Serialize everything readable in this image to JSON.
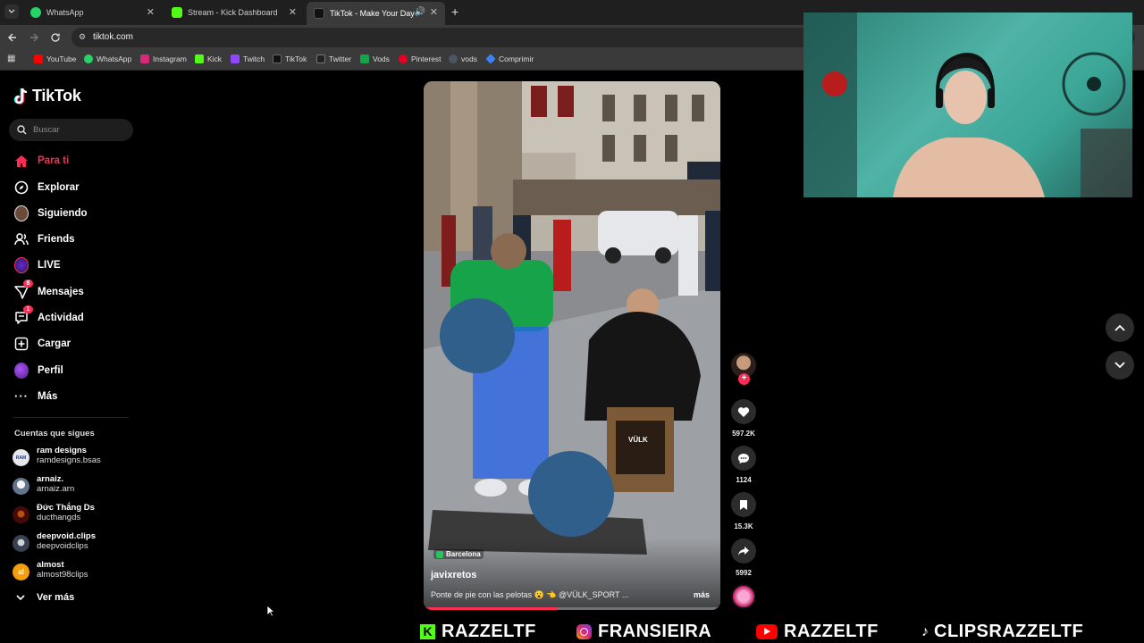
{
  "browser": {
    "tabs": [
      {
        "title": "WhatsApp",
        "color": "#25d366"
      },
      {
        "title": "Stream - Kick Dashboard",
        "color": "#53fc18"
      },
      {
        "title": "TikTok - Make Your Day",
        "color": "#111111"
      }
    ],
    "url": "tiktok.com",
    "bookmarks": [
      {
        "label": "YouTube",
        "color": "#ff0000"
      },
      {
        "label": "WhatsApp",
        "color": "#25d366"
      },
      {
        "label": "Instagram",
        "color": "#d62976"
      },
      {
        "label": "Kick",
        "color": "#53fc18"
      },
      {
        "label": "Twitch",
        "color": "#9146ff"
      },
      {
        "label": "TikTok",
        "color": "#111111"
      },
      {
        "label": "Twitter",
        "color": "#222222"
      },
      {
        "label": "Vods",
        "color": "#16a34a"
      },
      {
        "label": "Pinterest",
        "color": "#e60023"
      },
      {
        "label": "vods",
        "color": "#4b5563"
      },
      {
        "label": "Comprimir",
        "color": "#3b82f6"
      }
    ]
  },
  "tiktok": {
    "logo": "TikTok",
    "search_placeholder": "Buscar",
    "nav": [
      {
        "label": "Para ti",
        "icon": "home-icon",
        "active": true
      },
      {
        "label": "Explorar",
        "icon": "compass-icon"
      },
      {
        "label": "Siguiendo",
        "icon": "following-avatar-icon"
      },
      {
        "label": "Friends",
        "icon": "friends-icon"
      },
      {
        "label": "LIVE",
        "icon": "live-icon"
      },
      {
        "label": "Mensajes",
        "icon": "messages-icon",
        "badge": "8"
      },
      {
        "label": "Actividad",
        "icon": "activity-icon",
        "badge": "1"
      },
      {
        "label": "Cargar",
        "icon": "upload-icon"
      },
      {
        "label": "Perfil",
        "icon": "profile-icon"
      },
      {
        "label": "Más",
        "icon": "more-icon"
      }
    ],
    "following_header": "Cuentas que sigues",
    "following": [
      {
        "name": "ram designs",
        "handle": "ramdesigns.bsas",
        "avatar_text": "RAM",
        "color": "#e5e7eb"
      },
      {
        "name": "arnaiz.",
        "handle": "arnaiz.arn",
        "avatar_text": "",
        "color": "#94a3b8"
      },
      {
        "name": "Đức Thắng Ds",
        "handle": "ducthangds",
        "avatar_text": "",
        "color": "#7f1d1d"
      },
      {
        "name": "deepvoid.clips",
        "handle": "deepvoidclips",
        "avatar_text": "",
        "color": "#6b7280"
      },
      {
        "name": "almost",
        "handle": "almost98clips",
        "avatar_text": "al",
        "color": "#f59e0b"
      }
    ],
    "see_more": "Ver más",
    "video": {
      "location": "Barcelona",
      "author": "javixretos",
      "caption": "Ponte de pie con las pelotas 😮 👈 @VÜLK_SPORT ...",
      "more": "más",
      "box_label": "VÜLK"
    },
    "actions": {
      "likes": "597.2K",
      "comments": "1124",
      "saves": "15.3K",
      "shares": "5992"
    }
  },
  "overlay": {
    "banner": [
      {
        "label": "RAZZELTF",
        "icon": "kick-icon",
        "color": "#53fc18"
      },
      {
        "label": "FRANSIEIRA",
        "icon": "instagram-icon",
        "color": "#d62976"
      },
      {
        "label": "RAZZELTF",
        "icon": "youtube-icon",
        "color": "#ff0000"
      },
      {
        "label": "CLIPSRAZZELTF",
        "icon": "tiktok-icon",
        "color": "#ffffff"
      }
    ]
  }
}
